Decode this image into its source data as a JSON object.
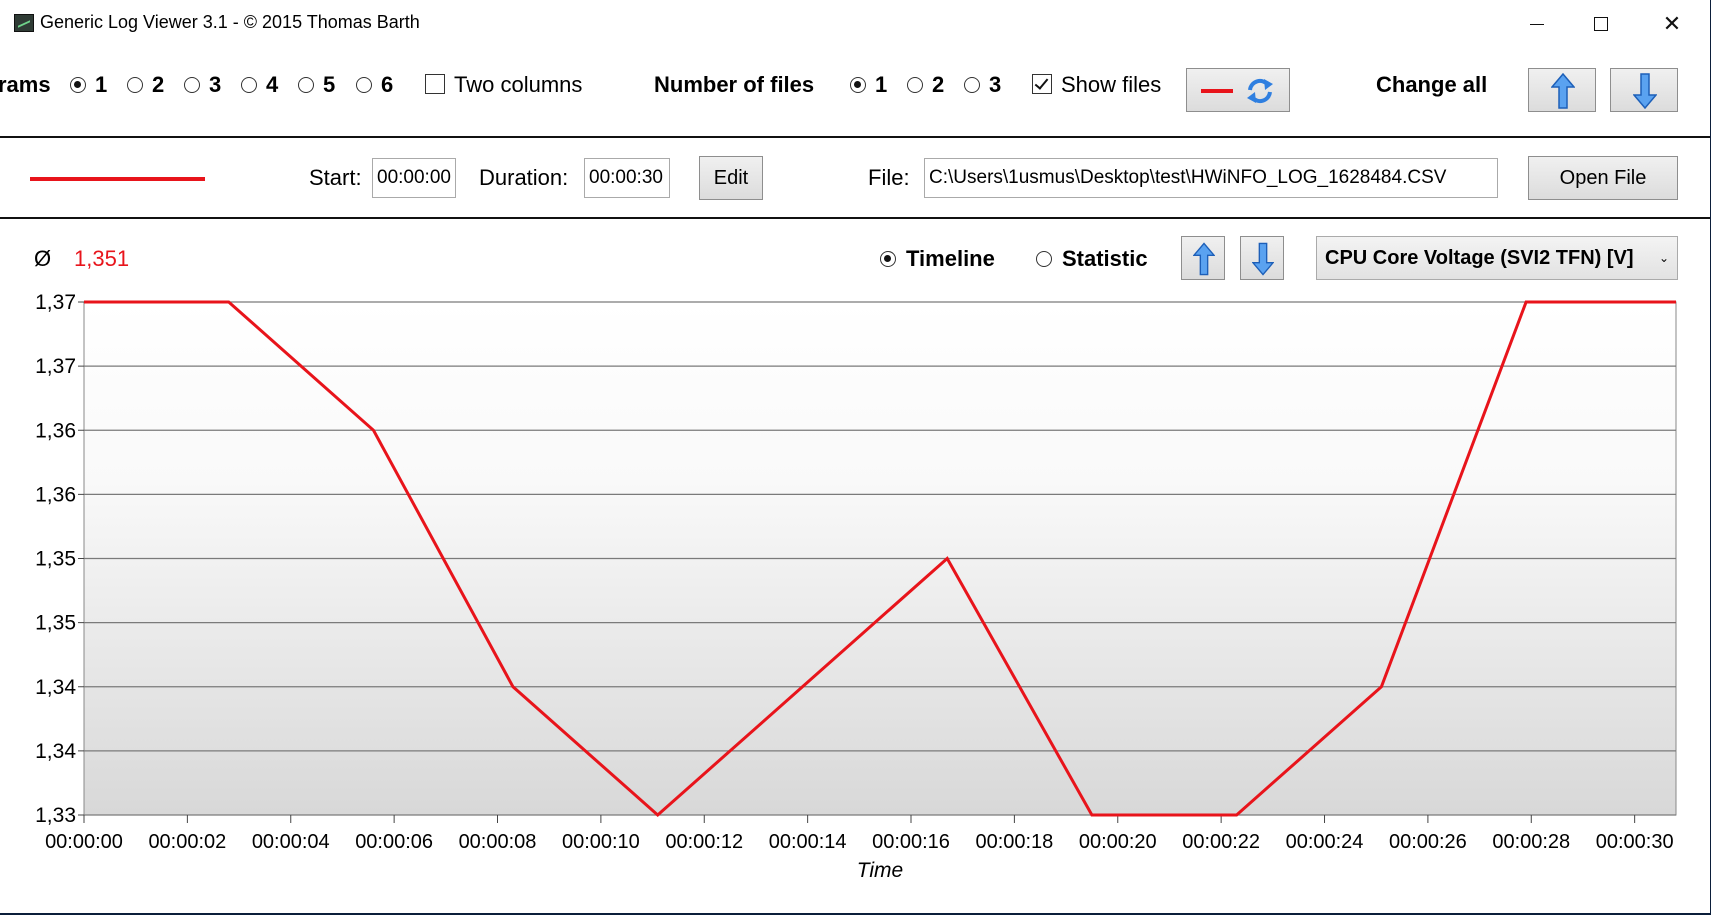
{
  "window": {
    "title": "Generic Log Viewer 3.1 - © 2015 Thomas Barth"
  },
  "toolbar": {
    "diagrams_label": "rams",
    "diagram_options": [
      "1",
      "2",
      "3",
      "4",
      "5",
      "6"
    ],
    "diagram_selected": "1",
    "two_columns_label": "Two columns",
    "two_columns_checked": false,
    "number_of_files_label": "Number of files",
    "file_count_options": [
      "1",
      "2",
      "3"
    ],
    "file_count_selected": "1",
    "show_files_label": "Show files",
    "show_files_checked": true,
    "change_all_label": "Change all"
  },
  "file_row": {
    "line_color": "#e8141b",
    "start_label": "Start:",
    "start_value": "00:00:00",
    "duration_label": "Duration:",
    "duration_value": "00:00:30",
    "edit_label": "Edit",
    "file_label": "File:",
    "file_value": "C:\\Users\\1usmus\\Desktop\\test\\HWiNFO_LOG_1628484.CSV",
    "open_file_label": "Open File"
  },
  "diagram": {
    "avg_symbol": "Ø",
    "avg_value": "1,351",
    "mode_timeline": "Timeline",
    "mode_statistic": "Statistic",
    "mode_selected": "Timeline",
    "sensor": "CPU Core Voltage (SVI2 TFN) [V]"
  },
  "colors": {
    "accent": "#e8141b",
    "button_blue": "#2f7fe0"
  },
  "chart_data": {
    "type": "line",
    "xlabel": "Time",
    "ylabel": "",
    "x_ticks": [
      "00:00:00",
      "00:00:02",
      "00:00:04",
      "00:00:06",
      "00:00:08",
      "00:00:10",
      "00:00:12",
      "00:00:14",
      "00:00:16",
      "00:00:18",
      "00:00:20",
      "00:00:22",
      "00:00:24",
      "00:00:26",
      "00:00:28",
      "00:00:30"
    ],
    "y_ticks": [
      "1,37",
      "1,37",
      "1,36",
      "1,36",
      "1,35",
      "1,35",
      "1,34",
      "1,34",
      "1,33"
    ],
    "xlim_seconds": [
      0,
      30.8
    ],
    "ylim": [
      1.33,
      1.37
    ],
    "grid": true,
    "series": [
      {
        "color": "#e8141b",
        "x_seconds": [
          0,
          2.8,
          5.6,
          8.3,
          11.1,
          16.7,
          19.5,
          22.3,
          25.1,
          27.9,
          30.8
        ],
        "values": [
          1.37,
          1.37,
          1.36,
          1.34,
          1.33,
          1.35,
          1.33,
          1.33,
          1.34,
          1.37,
          1.37
        ]
      }
    ]
  }
}
